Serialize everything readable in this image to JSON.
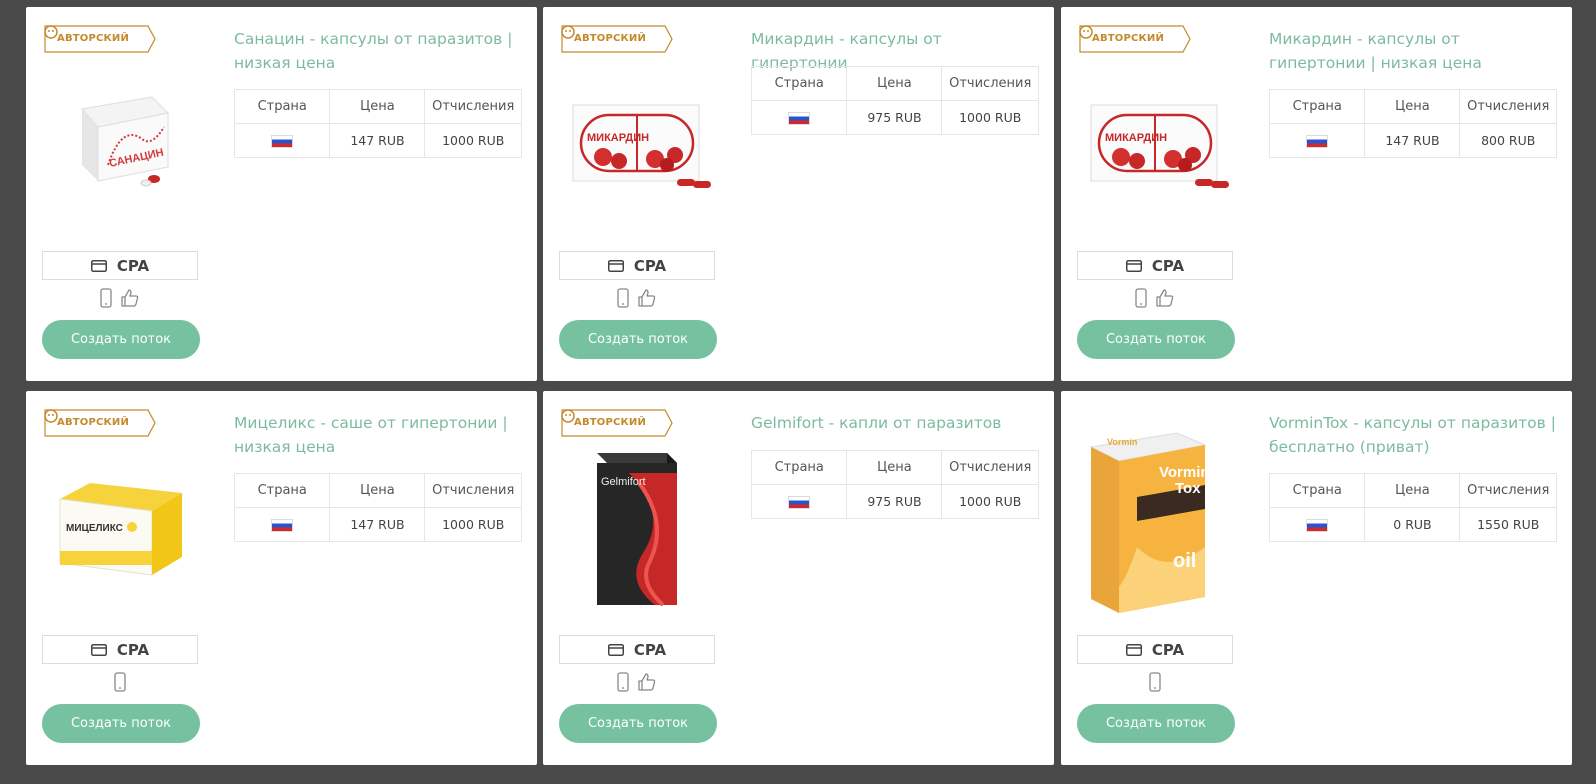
{
  "common": {
    "badge": "АВТОРСКИЙ",
    "cpa_label": "CPA",
    "create_button": "Создать поток",
    "col_country": "Страна",
    "col_price": "Цена",
    "col_payout": "Отчисления"
  },
  "offers": [
    {
      "title": "Санацин - капсулы от паразитов | низкая цена",
      "badge": true,
      "price": "147 RUB",
      "payout": "1000 RUB",
      "like": true,
      "image": "sanacin-box"
    },
    {
      "title": "Микардин - капсулы от гипертонии",
      "badge": true,
      "price": "975 RUB",
      "payout": "1000 RUB",
      "like": true,
      "image": "mikardin-box"
    },
    {
      "title": "Микардин - капсулы от гипертонии | низкая цена",
      "badge": true,
      "price": "147 RUB",
      "payout": "800 RUB",
      "like": true,
      "image": "mikardin-box"
    },
    {
      "title": "Мицеликс - саше от гипертонии | низкая цена",
      "badge": true,
      "price": "147 RUB",
      "payout": "1000 RUB",
      "like": false,
      "image": "micelix-box"
    },
    {
      "title": "Gelmifort - капли от паразитов",
      "badge": true,
      "price": "975 RUB",
      "payout": "1000 RUB",
      "like": true,
      "image": "gelmifort-box"
    },
    {
      "title": "VorminTox - капсулы от паразитов | бесплатно (приват)",
      "badge": false,
      "price": "0 RUB",
      "payout": "1550 RUB",
      "like": false,
      "image": "vormintox-box"
    }
  ],
  "product_texts": {
    "sanacin": "САНАЦИН",
    "mikardin": "МИКАРДИН",
    "micelix": "МИЦЕЛИКС",
    "gelmifort": "Gelmifort",
    "vormin": "Vormin",
    "tox": "Tox",
    "oil": "oil"
  },
  "colors": {
    "accent": "#76c1a0",
    "title": "#7dbb9e",
    "badge": "#c48a2a",
    "background": "#4a4a4a"
  }
}
